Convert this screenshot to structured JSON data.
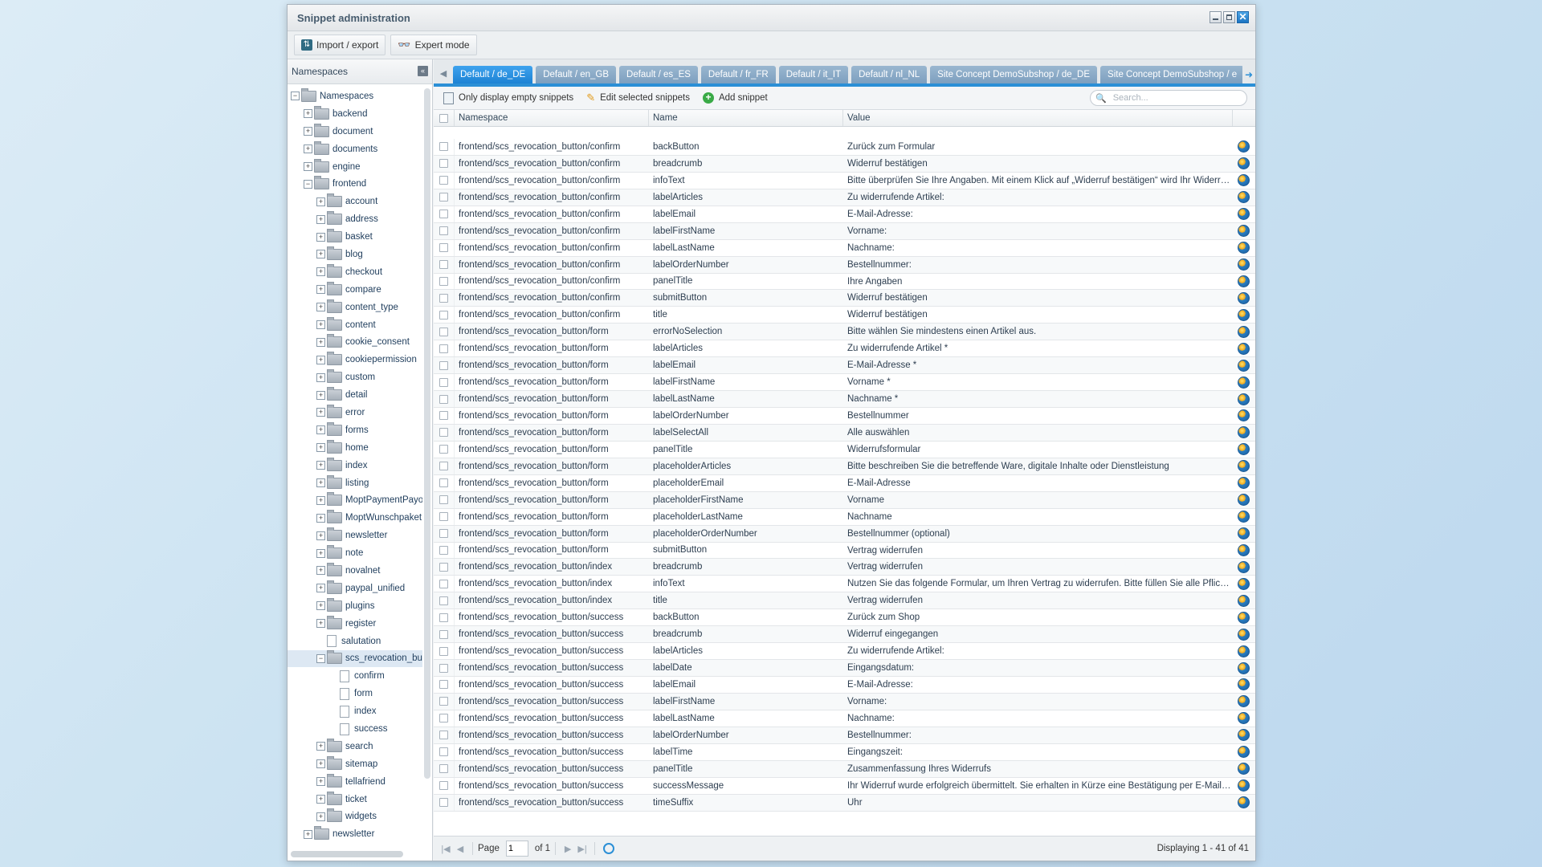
{
  "window": {
    "title": "Snippet administration"
  },
  "toolbar": {
    "import_export": "Import / export",
    "expert_mode": "Expert mode"
  },
  "sidebar": {
    "title": "Namespaces",
    "tree": [
      {
        "label": "Namespaces",
        "level": 0,
        "type": "folder",
        "exp": "−"
      },
      {
        "label": "backend",
        "level": 1,
        "type": "folder",
        "exp": "+"
      },
      {
        "label": "document",
        "level": 1,
        "type": "folder",
        "exp": "+"
      },
      {
        "label": "documents",
        "level": 1,
        "type": "folder",
        "exp": "+"
      },
      {
        "label": "engine",
        "level": 1,
        "type": "folder",
        "exp": "+"
      },
      {
        "label": "frontend",
        "level": 1,
        "type": "folder",
        "exp": "−"
      },
      {
        "label": "account",
        "level": 2,
        "type": "folder",
        "exp": "+"
      },
      {
        "label": "address",
        "level": 2,
        "type": "folder",
        "exp": "+"
      },
      {
        "label": "basket",
        "level": 2,
        "type": "folder",
        "exp": "+"
      },
      {
        "label": "blog",
        "level": 2,
        "type": "folder",
        "exp": "+"
      },
      {
        "label": "checkout",
        "level": 2,
        "type": "folder",
        "exp": "+"
      },
      {
        "label": "compare",
        "level": 2,
        "type": "folder",
        "exp": "+"
      },
      {
        "label": "content_type",
        "level": 2,
        "type": "folder",
        "exp": "+"
      },
      {
        "label": "content",
        "level": 2,
        "type": "folder",
        "exp": "+"
      },
      {
        "label": "cookie_consent",
        "level": 2,
        "type": "folder",
        "exp": "+"
      },
      {
        "label": "cookiepermission",
        "level": 2,
        "type": "folder",
        "exp": "+"
      },
      {
        "label": "custom",
        "level": 2,
        "type": "folder",
        "exp": "+"
      },
      {
        "label": "detail",
        "level": 2,
        "type": "folder",
        "exp": "+"
      },
      {
        "label": "error",
        "level": 2,
        "type": "folder",
        "exp": "+"
      },
      {
        "label": "forms",
        "level": 2,
        "type": "folder",
        "exp": "+"
      },
      {
        "label": "home",
        "level": 2,
        "type": "folder",
        "exp": "+"
      },
      {
        "label": "index",
        "level": 2,
        "type": "folder",
        "exp": "+"
      },
      {
        "label": "listing",
        "level": 2,
        "type": "folder",
        "exp": "+"
      },
      {
        "label": "MoptPaymentPayor",
        "level": 2,
        "type": "folder",
        "exp": "+"
      },
      {
        "label": "MoptWunschpaket",
        "level": 2,
        "type": "folder",
        "exp": "+"
      },
      {
        "label": "newsletter",
        "level": 2,
        "type": "folder",
        "exp": "+"
      },
      {
        "label": "note",
        "level": 2,
        "type": "folder",
        "exp": "+"
      },
      {
        "label": "novalnet",
        "level": 2,
        "type": "folder",
        "exp": "+"
      },
      {
        "label": "paypal_unified",
        "level": 2,
        "type": "folder",
        "exp": "+"
      },
      {
        "label": "plugins",
        "level": 2,
        "type": "folder",
        "exp": "+"
      },
      {
        "label": "register",
        "level": 2,
        "type": "folder",
        "exp": "+"
      },
      {
        "label": "salutation",
        "level": 2,
        "type": "file",
        "exp": ""
      },
      {
        "label": "scs_revocation_butt",
        "level": 2,
        "type": "folder",
        "exp": "−",
        "selected": true
      },
      {
        "label": "confirm",
        "level": 3,
        "type": "file",
        "exp": ""
      },
      {
        "label": "form",
        "level": 3,
        "type": "file",
        "exp": ""
      },
      {
        "label": "index",
        "level": 3,
        "type": "file",
        "exp": ""
      },
      {
        "label": "success",
        "level": 3,
        "type": "file",
        "exp": ""
      },
      {
        "label": "search",
        "level": 2,
        "type": "folder",
        "exp": "+"
      },
      {
        "label": "sitemap",
        "level": 2,
        "type": "folder",
        "exp": "+"
      },
      {
        "label": "tellafriend",
        "level": 2,
        "type": "folder",
        "exp": "+"
      },
      {
        "label": "ticket",
        "level": 2,
        "type": "folder",
        "exp": "+"
      },
      {
        "label": "widgets",
        "level": 2,
        "type": "folder",
        "exp": "+"
      },
      {
        "label": "newsletter",
        "level": 1,
        "type": "folder",
        "exp": "+"
      }
    ]
  },
  "tabs": [
    {
      "label": "Default / de_DE",
      "active": true
    },
    {
      "label": "Default / en_GB"
    },
    {
      "label": "Default / es_ES"
    },
    {
      "label": "Default / fr_FR"
    },
    {
      "label": "Default / it_IT"
    },
    {
      "label": "Default / nl_NL"
    },
    {
      "label": "Site Concept DemoSubshop / de_DE"
    },
    {
      "label": "Site Concept DemoSubshop / e"
    }
  ],
  "grid_toolbar": {
    "only_empty": "Only display empty snippets",
    "edit_selected": "Edit selected snippets",
    "add_snippet": "Add snippet",
    "search_placeholder": "Search..."
  },
  "grid": {
    "columns": {
      "namespace": "Namespace",
      "name": "Name",
      "value": "Value"
    },
    "rows": [
      [
        "frontend/scs_revocation_button/confirm",
        "backButton",
        "Zurück zum Formular"
      ],
      [
        "frontend/scs_revocation_button/confirm",
        "breadcrumb",
        "Widerruf bestätigen"
      ],
      [
        "frontend/scs_revocation_button/confirm",
        "infoText",
        "Bitte überprüfen Sie Ihre Angaben. Mit einem Klick auf „Widerruf bestätigen“ wird Ihr Widerruf v..."
      ],
      [
        "frontend/scs_revocation_button/confirm",
        "labelArticles",
        "Zu widerrufende Artikel:"
      ],
      [
        "frontend/scs_revocation_button/confirm",
        "labelEmail",
        "E-Mail-Adresse:"
      ],
      [
        "frontend/scs_revocation_button/confirm",
        "labelFirstName",
        "Vorname:"
      ],
      [
        "frontend/scs_revocation_button/confirm",
        "labelLastName",
        "Nachname:"
      ],
      [
        "frontend/scs_revocation_button/confirm",
        "labelOrderNumber",
        "Bestellnummer:"
      ],
      [
        "frontend/scs_revocation_button/confirm",
        "panelTitle",
        "Ihre Angaben"
      ],
      [
        "frontend/scs_revocation_button/confirm",
        "submitButton",
        "Widerruf bestätigen"
      ],
      [
        "frontend/scs_revocation_button/confirm",
        "title",
        "Widerruf bestätigen"
      ],
      [
        "frontend/scs_revocation_button/form",
        "errorNoSelection",
        "Bitte wählen Sie mindestens einen Artikel aus."
      ],
      [
        "frontend/scs_revocation_button/form",
        "labelArticles",
        "Zu widerrufende Artikel *"
      ],
      [
        "frontend/scs_revocation_button/form",
        "labelEmail",
        "E-Mail-Adresse *"
      ],
      [
        "frontend/scs_revocation_button/form",
        "labelFirstName",
        "Vorname *"
      ],
      [
        "frontend/scs_revocation_button/form",
        "labelLastName",
        "Nachname *"
      ],
      [
        "frontend/scs_revocation_button/form",
        "labelOrderNumber",
        "Bestellnummer"
      ],
      [
        "frontend/scs_revocation_button/form",
        "labelSelectAll",
        "Alle auswählen"
      ],
      [
        "frontend/scs_revocation_button/form",
        "panelTitle",
        "Widerrufsformular"
      ],
      [
        "frontend/scs_revocation_button/form",
        "placeholderArticles",
        "Bitte beschreiben Sie die betreffende Ware, digitale Inhalte oder Dienstleistung"
      ],
      [
        "frontend/scs_revocation_button/form",
        "placeholderEmail",
        "E-Mail-Adresse"
      ],
      [
        "frontend/scs_revocation_button/form",
        "placeholderFirstName",
        "Vorname"
      ],
      [
        "frontend/scs_revocation_button/form",
        "placeholderLastName",
        "Nachname"
      ],
      [
        "frontend/scs_revocation_button/form",
        "placeholderOrderNumber",
        "Bestellnummer (optional)"
      ],
      [
        "frontend/scs_revocation_button/form",
        "submitButton",
        "Vertrag widerrufen"
      ],
      [
        "frontend/scs_revocation_button/index",
        "breadcrumb",
        "Vertrag widerrufen"
      ],
      [
        "frontend/scs_revocation_button/index",
        "infoText",
        "Nutzen Sie das folgende Formular, um Ihren Vertrag zu widerrufen. Bitte füllen Sie alle Pflichtfe..."
      ],
      [
        "frontend/scs_revocation_button/index",
        "title",
        "Vertrag widerrufen"
      ],
      [
        "frontend/scs_revocation_button/success",
        "backButton",
        "Zurück zum Shop"
      ],
      [
        "frontend/scs_revocation_button/success",
        "breadcrumb",
        "Widerruf eingegangen"
      ],
      [
        "frontend/scs_revocation_button/success",
        "labelArticles",
        "Zu widerrufende Artikel:"
      ],
      [
        "frontend/scs_revocation_button/success",
        "labelDate",
        "Eingangsdatum:"
      ],
      [
        "frontend/scs_revocation_button/success",
        "labelEmail",
        "E-Mail-Adresse:"
      ],
      [
        "frontend/scs_revocation_button/success",
        "labelFirstName",
        "Vorname:"
      ],
      [
        "frontend/scs_revocation_button/success",
        "labelLastName",
        "Nachname:"
      ],
      [
        "frontend/scs_revocation_button/success",
        "labelOrderNumber",
        "Bestellnummer:"
      ],
      [
        "frontend/scs_revocation_button/success",
        "labelTime",
        "Eingangszeit:"
      ],
      [
        "frontend/scs_revocation_button/success",
        "panelTitle",
        "Zusammenfassung Ihres Widerrufs"
      ],
      [
        "frontend/scs_revocation_button/success",
        "successMessage",
        "Ihr Widerruf wurde erfolgreich übermittelt. Sie erhalten in Kürze eine Bestätigung per E-Mail an"
      ],
      [
        "frontend/scs_revocation_button/success",
        "timeSuffix",
        "Uhr"
      ],
      [
        "frontend/scs_revocation_button/success",
        "title",
        "Widerruf eingegangen"
      ]
    ]
  },
  "pager": {
    "page_label": "Page",
    "page_value": "1",
    "of_label": "of 1",
    "displaying": "Displaying 1 - 41 of 41"
  },
  "colors": {
    "accent": "#2b8fd6",
    "tab_inactive": "#8fb0cc"
  }
}
